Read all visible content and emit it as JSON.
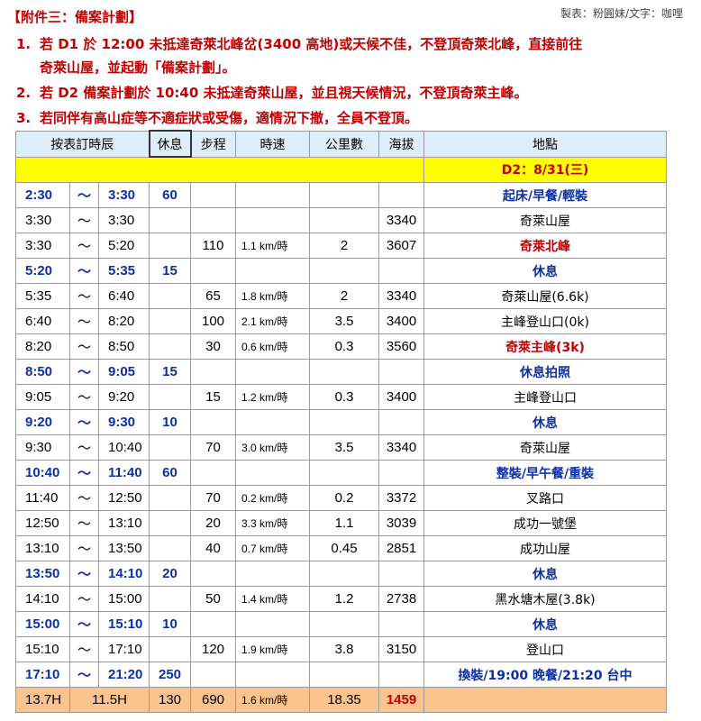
{
  "title": "【附件三：備案計劃】",
  "credit": "製表：粉圓妹/文字：咖哩",
  "notes": [
    {
      "num": "1.",
      "text": "若 D1 於 12:00 未抵達奇萊北峰岔(3400 高地)或天候不佳，不登頂奇萊北峰，直接前往",
      "cont": "奇萊山屋，並起動「備案計劃」。"
    },
    {
      "num": "2.",
      "text": "若 D2 備案計劃於 10:40 未抵達奇萊山屋，並且視天候情況，不登頂奇萊主峰。"
    },
    {
      "num": "3.",
      "text": "若同伴有高山症等不適症狀或受傷，適情況下撤，全員不登頂。"
    }
  ],
  "headers": {
    "schedule": "按表訂時辰",
    "rest": "休息",
    "steps": "步程",
    "speed": "時速",
    "km": "公里數",
    "alt": "海拔",
    "place": "地點"
  },
  "day_label": "D2：8/31(三)",
  "colors": {
    "red": "#c00000",
    "blue": "#0b2fa6",
    "header": "#ddeef9",
    "date_row": "#ffff00",
    "summary": "#fbc48f"
  },
  "rows": [
    {
      "start": "2:30",
      "sep": "～",
      "end": "3:30",
      "rest": "60",
      "steps": "",
      "speed": "",
      "km": "",
      "alt": "",
      "place": "起床/早餐/輕裝",
      "kind": "blue"
    },
    {
      "start": "3:30",
      "sep": "～",
      "end": "3:30",
      "rest": "",
      "steps": "",
      "speed": "",
      "km": "",
      "alt": "3340",
      "place": "奇萊山屋",
      "kind": "normal"
    },
    {
      "start": "3:30",
      "sep": "～",
      "end": "5:20",
      "rest": "",
      "steps": "110",
      "speed": "1.1 km/時",
      "km": "2",
      "alt": "3607",
      "place": "奇萊北峰",
      "kind": "red"
    },
    {
      "start": "5:20",
      "sep": "～",
      "end": "5:35",
      "rest": "15",
      "steps": "",
      "speed": "",
      "km": "",
      "alt": "",
      "place": "休息",
      "kind": "blue"
    },
    {
      "start": "5:35",
      "sep": "～",
      "end": "6:40",
      "rest": "",
      "steps": "65",
      "speed": "1.8 km/時",
      "km": "2",
      "alt": "3340",
      "place": "奇萊山屋(6.6k)",
      "kind": "normal"
    },
    {
      "start": "6:40",
      "sep": "～",
      "end": "8:20",
      "rest": "",
      "steps": "100",
      "speed": "2.1 km/時",
      "km": "3.5",
      "alt": "3400",
      "place": "主峰登山口(0k)",
      "kind": "normal"
    },
    {
      "start": "8:20",
      "sep": "～",
      "end": "8:50",
      "rest": "",
      "steps": "30",
      "speed": "0.6 km/時",
      "km": "0.3",
      "alt": "3560",
      "place": "奇萊主峰(3k)",
      "kind": "red"
    },
    {
      "start": "8:50",
      "sep": "～",
      "end": "9:05",
      "rest": "15",
      "steps": "",
      "speed": "",
      "km": "",
      "alt": "",
      "place": "休息拍照",
      "kind": "blue"
    },
    {
      "start": "9:05",
      "sep": "～",
      "end": "9:20",
      "rest": "",
      "steps": "15",
      "speed": "1.2 km/時",
      "km": "0.3",
      "alt": "3400",
      "place": "主峰登山口",
      "kind": "normal"
    },
    {
      "start": "9:20",
      "sep": "～",
      "end": "9:30",
      "rest": "10",
      "steps": "",
      "speed": "",
      "km": "",
      "alt": "",
      "place": "休息",
      "kind": "blue"
    },
    {
      "start": "9:30",
      "sep": "～",
      "end": "10:40",
      "rest": "",
      "steps": "70",
      "speed": "3.0 km/時",
      "km": "3.5",
      "alt": "3340",
      "place": "奇萊山屋",
      "kind": "normal"
    },
    {
      "start": "10:40",
      "sep": "～",
      "end": "11:40",
      "rest": "60",
      "steps": "",
      "speed": "",
      "km": "",
      "alt": "",
      "place": "整裝/早午餐/重裝",
      "kind": "blue"
    },
    {
      "start": "11:40",
      "sep": "～",
      "end": "12:50",
      "rest": "",
      "steps": "70",
      "speed": "0.2 km/時",
      "km": "0.2",
      "alt": "3372",
      "place": "叉路口",
      "kind": "normal"
    },
    {
      "start": "12:50",
      "sep": "～",
      "end": "13:10",
      "rest": "",
      "steps": "20",
      "speed": "3.3 km/時",
      "km": "1.1",
      "alt": "3039",
      "place": "成功一號堡",
      "kind": "normal"
    },
    {
      "start": "13:10",
      "sep": "～",
      "end": "13:50",
      "rest": "",
      "steps": "40",
      "speed": "0.7 km/時",
      "km": "0.45",
      "alt": "2851",
      "place": "成功山屋",
      "kind": "normal"
    },
    {
      "start": "13:50",
      "sep": "～",
      "end": "14:10",
      "rest": "20",
      "steps": "",
      "speed": "",
      "km": "",
      "alt": "",
      "place": "休息",
      "kind": "blue"
    },
    {
      "start": "14:10",
      "sep": "～",
      "end": "15:00",
      "rest": "",
      "steps": "50",
      "speed": "1.4 km/時",
      "km": "1.2",
      "alt": "2738",
      "place": "黑水塘木屋(3.8k)",
      "kind": "normal"
    },
    {
      "start": "15:00",
      "sep": "～",
      "end": "15:10",
      "rest": "10",
      "steps": "",
      "speed": "",
      "km": "",
      "alt": "",
      "place": "休息",
      "kind": "blue"
    },
    {
      "start": "15:10",
      "sep": "～",
      "end": "17:10",
      "rest": "",
      "steps": "120",
      "speed": "1.9 km/時",
      "km": "3.8",
      "alt": "3150",
      "place": "登山口",
      "kind": "normal"
    },
    {
      "start": "17:10",
      "sep": "～",
      "end": "21:20",
      "rest": "250",
      "steps": "",
      "speed": "",
      "km": "",
      "alt": "",
      "place": "換裝/19:00 晚餐/21:20 台中",
      "kind": "blue"
    }
  ],
  "summary": {
    "total": "13.7H",
    "walk": "11.5H",
    "rest": "130",
    "steps": "690",
    "speed": "1.6 km/時",
    "km": "18.35",
    "alt": "1459"
  }
}
